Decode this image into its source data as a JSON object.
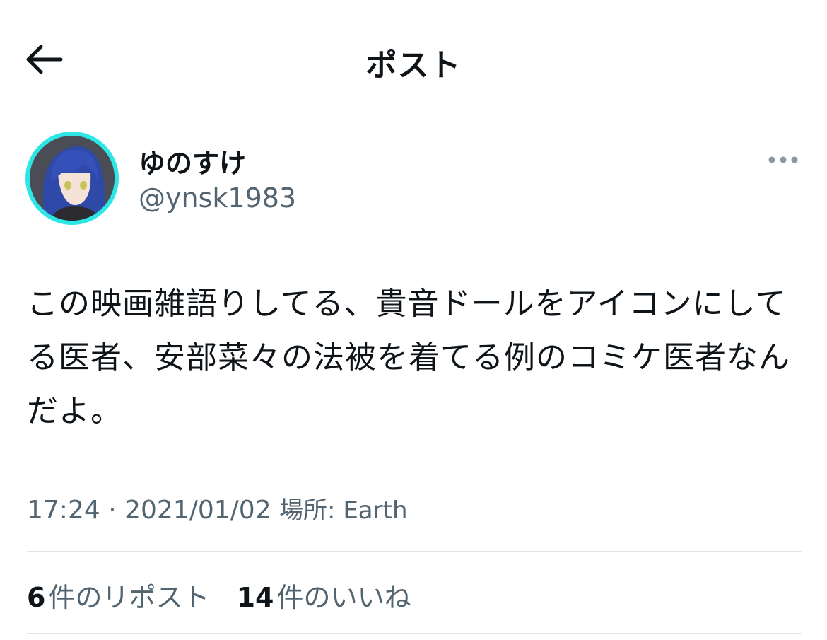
{
  "header": {
    "title": "ポスト",
    "back_icon": "arrow-left-icon"
  },
  "author": {
    "display_name": "ゆのすけ",
    "handle": "@ynsk1983",
    "avatar_ring_color": "#2ee6e6",
    "more_icon": "more-horizontal-icon"
  },
  "post": {
    "text": "この映画雑語りしてる、貴音ドールをアイコンにしてる医者、安部菜々の法被を着てる例のコミケ医者なんだよ。"
  },
  "meta": {
    "time": "17:24",
    "separator": "·",
    "date": "2021/01/02",
    "place": "場所: Earth"
  },
  "stats": {
    "reposts_count": "6",
    "reposts_label": "件のリポスト",
    "likes_count": "14",
    "likes_label": "件のいいね"
  }
}
